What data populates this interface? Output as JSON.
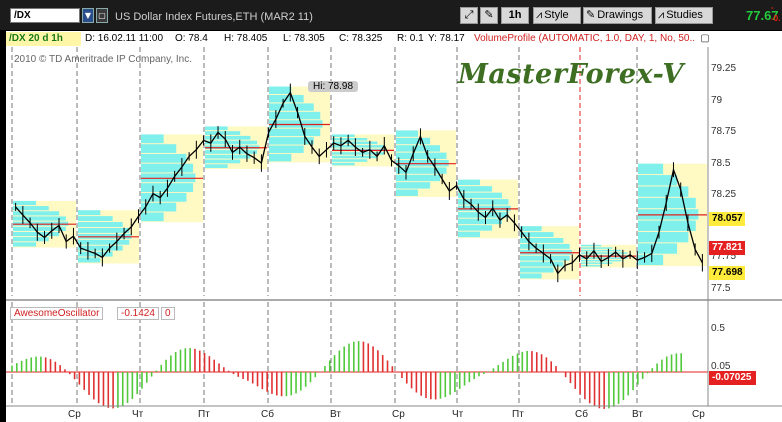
{
  "toolbar": {
    "symbol": "/DX",
    "description": "US Dollar Index Futures,ETH (MAR2 11)",
    "timeframe": "1h",
    "style_label": "Style",
    "drawings_label": "Drawings",
    "studies_label": "Studies",
    "last_price": "77.67",
    "change_top": "-",
    "change_bottom": "-0."
  },
  "info_bar": {
    "symbol_period": "/DX 20 d 1h",
    "date": "D: 16.02.11 11:00",
    "open": "O: 78.4",
    "high": "H: 78.405",
    "low": "L: 78.305",
    "close": "C: 78.325",
    "range": "R: 0.1",
    "y_readout": "Y: 78.17",
    "study": "VolumeProfile (AUTOMATIC, 1.0, DAY, 1, No, 50..."
  },
  "copyright": "2010 © TD Ameritrade IP Company, Inc.",
  "high_label": "Hi: 78.98",
  "watermark": "MasterForex-V",
  "price_panel": {
    "y_ticks": [
      "79.25",
      "79",
      "78.75",
      "78.5",
      "78.25",
      "78",
      "77.75",
      "77.5"
    ],
    "tag_upper": "78.057",
    "tag_current": "77.821",
    "tag_lower": "77.698"
  },
  "oscillator": {
    "name": "AwesomeOscillator",
    "value": "-0.1424",
    "flag": "0",
    "y_ticks": [
      "0.5",
      "0.05"
    ],
    "tag_value": "-0.07025"
  },
  "x_axis": [
    "Ср",
    "Чт",
    "Пт",
    "Сб",
    "Вт",
    "Ср",
    "Чт",
    "Пт",
    "Сб",
    "Вт",
    "Ср"
  ],
  "colors": {
    "candle": "#000000",
    "poc_line": "#e02020",
    "volume_profile": "#7ff0ec",
    "value_area": "#fff8b8",
    "osc_up": "#4fc93a",
    "osc_down": "#e03030",
    "price_green": "#24c93c",
    "session_divider": "#777777"
  },
  "chart_data": {
    "type": "line",
    "series": [
      {
        "values": [
          78.12,
          78.06,
          78.0,
          77.93,
          77.89,
          77.94,
          77.98,
          77.86,
          77.9,
          77.81,
          77.79,
          77.77,
          77.74,
          77.81,
          77.86,
          77.92,
          77.97,
          78.05,
          78.12,
          78.22,
          78.19,
          78.26,
          78.35,
          78.42,
          78.5,
          78.55,
          78.62,
          78.6,
          78.68,
          78.63,
          78.53,
          78.57,
          78.52,
          78.49,
          78.45,
          78.68,
          78.78,
          78.9,
          78.98,
          78.83,
          78.65,
          78.57,
          78.5,
          78.55,
          78.6,
          78.58,
          78.62,
          78.57,
          78.53,
          78.55,
          78.5,
          78.58,
          78.47,
          78.43,
          78.38,
          78.52,
          78.65,
          78.5,
          78.42,
          78.33,
          78.24,
          78.28,
          78.18,
          78.14,
          78.08,
          78.04,
          78.11,
          78.02,
          78.06,
          78.0,
          77.93,
          77.86,
          77.81,
          77.77,
          77.73,
          77.62,
          77.68,
          77.7,
          77.76,
          77.73,
          77.79,
          77.71,
          77.74,
          77.78,
          77.73,
          77.76,
          77.72,
          77.74,
          77.77,
          77.93,
          78.15,
          78.4,
          78.25,
          78.0,
          77.8,
          77.7
        ],
        "ylim": [
          77.45,
          79.3
        ]
      }
    ]
  }
}
